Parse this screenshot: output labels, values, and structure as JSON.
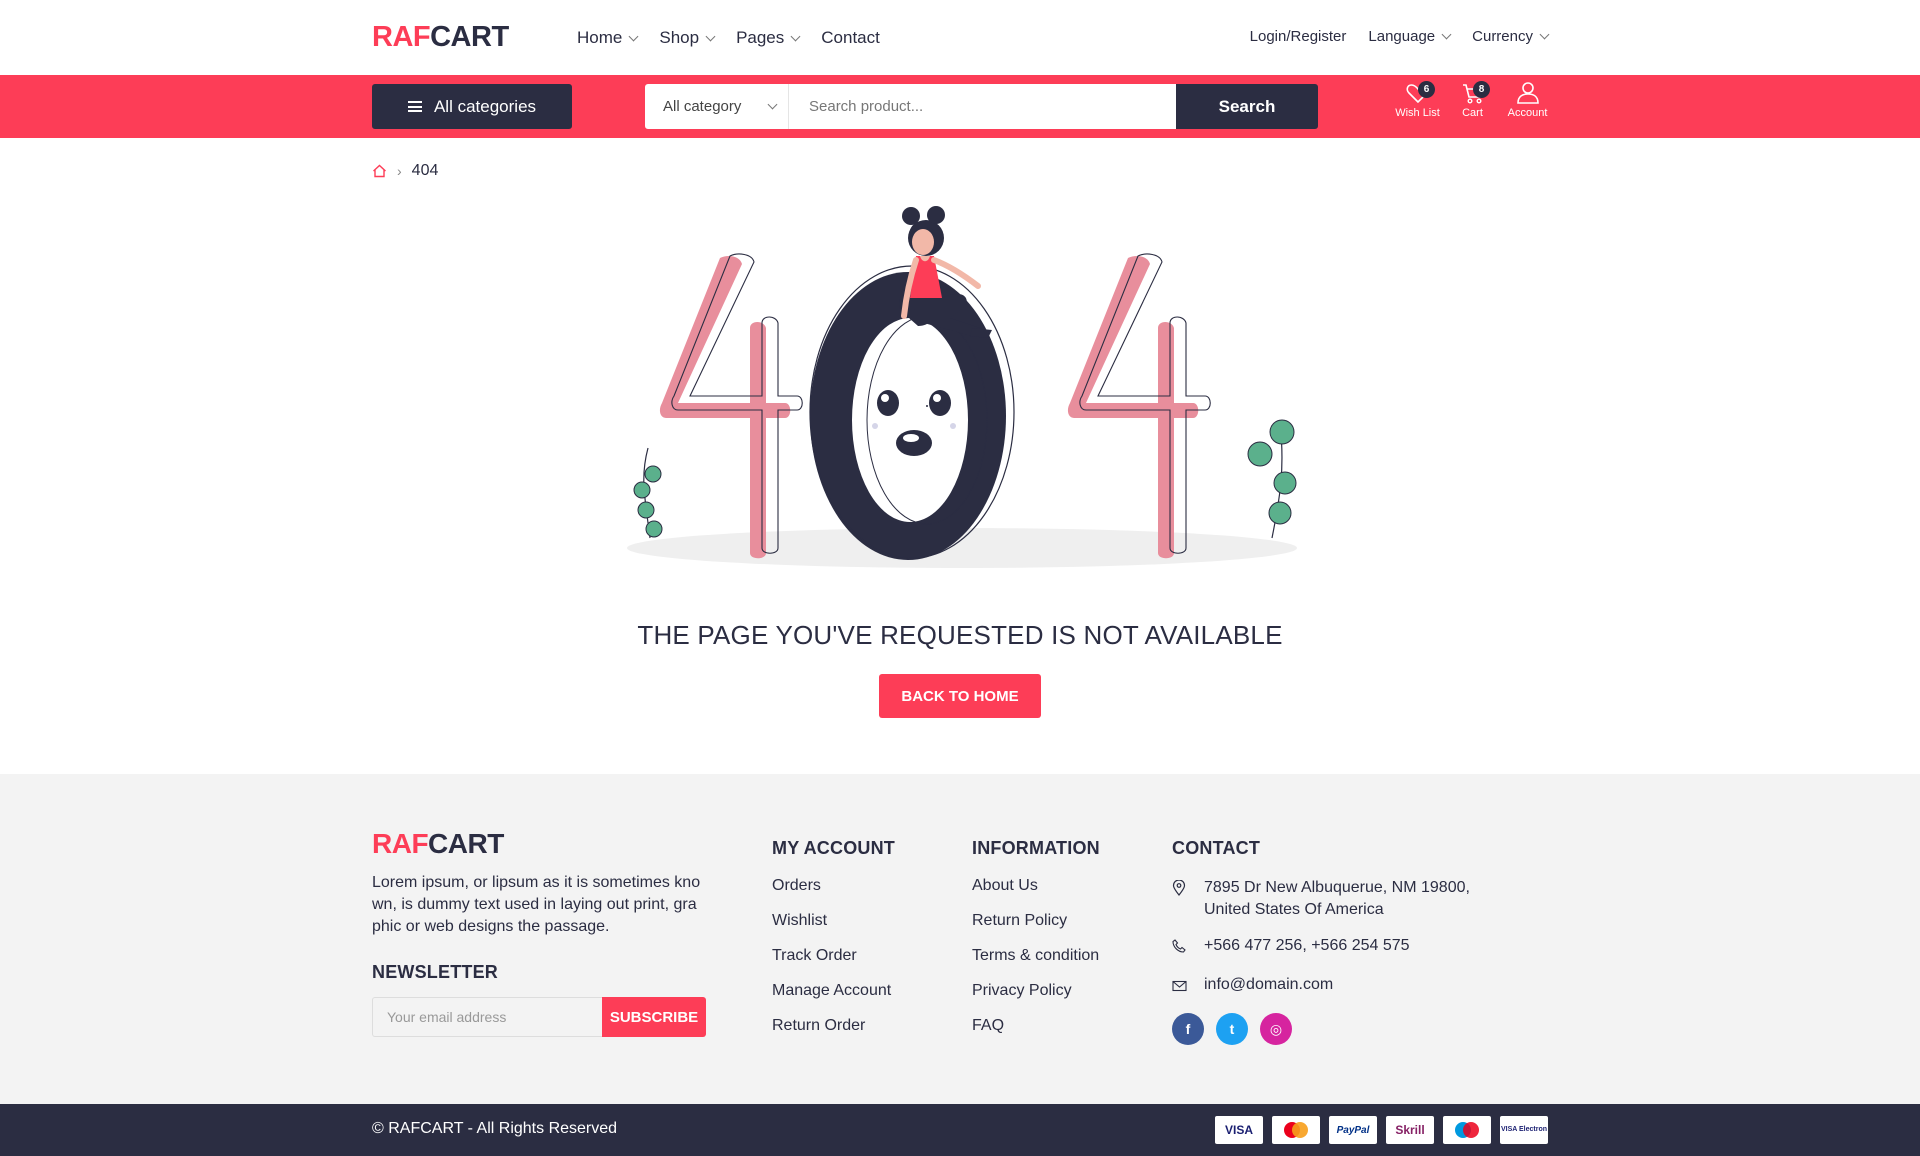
{
  "header": {
    "logo_part1": "RAF",
    "logo_part2": "CART",
    "nav": [
      {
        "label": "Home",
        "has_dropdown": true
      },
      {
        "label": "Shop",
        "has_dropdown": true
      },
      {
        "label": "Pages",
        "has_dropdown": true
      },
      {
        "label": "Contact",
        "has_dropdown": false
      }
    ],
    "login_label": "Login/Register",
    "language_label": "Language",
    "currency_label": "Currency"
  },
  "searchbar": {
    "all_categories_label": "All categories",
    "category_select_value": "All category",
    "search_placeholder": "Search product...",
    "search_button": "Search",
    "wishlist_label": "Wish List",
    "wishlist_count": "6",
    "cart_label": "Cart",
    "cart_count": "8",
    "account_label": "Account"
  },
  "breadcrumb": {
    "current": "404"
  },
  "error": {
    "message": "THE PAGE YOU'VE REQUESTED IS NOT AVAILABLE",
    "button": "BACK TO HOME"
  },
  "footer": {
    "logo_part1": "RAF",
    "logo_part2": "CART",
    "description": "Lorem ipsum, or lipsum as it is sometimes kno wn, is dummy text used in laying out print, gra phic or web designs the passage.",
    "newsletter_title": "NEWSLETTER",
    "newsletter_placeholder": "Your email address",
    "subscribe_button": "SUBSCRIBE",
    "my_account": {
      "title": "MY ACCOUNT",
      "links": [
        "Orders",
        "Wishlist",
        "Track Order",
        "Manage Account",
        "Return Order"
      ]
    },
    "information": {
      "title": "INFORMATION",
      "links": [
        "About Us",
        "Return Policy",
        "Terms & condition",
        "Privacy Policy",
        "FAQ"
      ]
    },
    "contact": {
      "title": "CONTACT",
      "address_line1": "7895 Dr New Albuquerue, NM 19800,",
      "address_line2": "United States Of America",
      "phone": "+566 477 256, +566 254 575",
      "email": "info@domain.com"
    },
    "social": [
      {
        "name": "facebook-icon",
        "glyph": "f",
        "color": "#3b5998"
      },
      {
        "name": "twitter-icon",
        "glyph": "t",
        "color": "#1da1f2"
      },
      {
        "name": "instagram-icon",
        "glyph": "◎",
        "color": "#d6249f"
      }
    ]
  },
  "bottom": {
    "copyright": "© RAFCART - All Rights Reserved",
    "payments": [
      "VISA",
      "MasterCard",
      "PayPal",
      "Skrill",
      "Maestro",
      "VISA Electron"
    ]
  },
  "colors": {
    "brand": "#fd3d57",
    "dark": "#2b2d42",
    "footer_bg": "#f3f3f3"
  }
}
